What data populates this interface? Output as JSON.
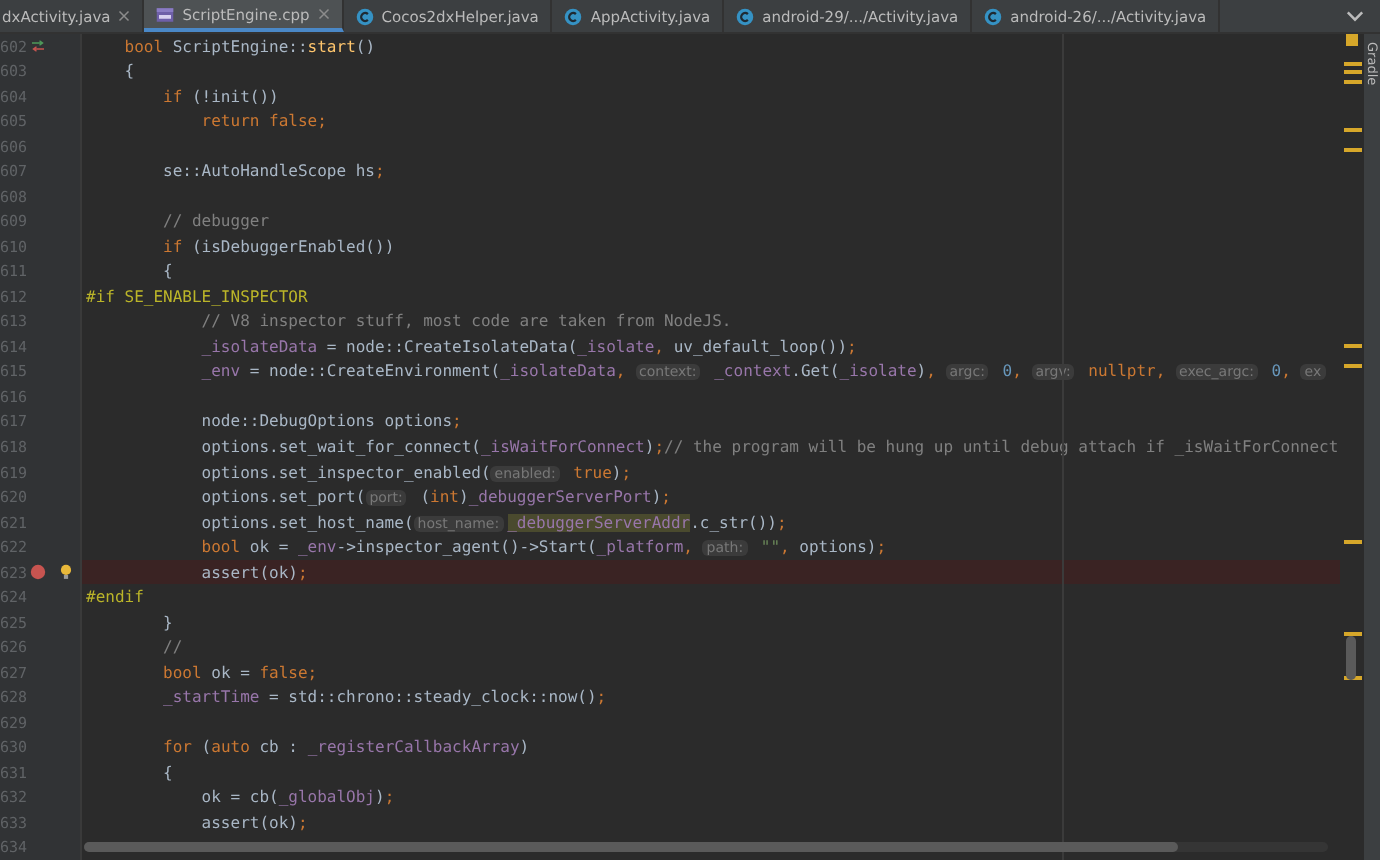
{
  "tabs": [
    {
      "label": "dxActivity.java",
      "selected": false,
      "kind": "none",
      "closable": true
    },
    {
      "label": "ScriptEngine.cpp",
      "selected": true,
      "kind": "cpp",
      "closable": true
    },
    {
      "label": "Cocos2dxHelper.java",
      "selected": false,
      "kind": "java",
      "closable": false
    },
    {
      "label": "AppActivity.java",
      "selected": false,
      "kind": "java",
      "closable": false
    },
    {
      "label": "android-29/.../Activity.java",
      "selected": false,
      "kind": "java",
      "closable": false
    },
    {
      "label": "android-26/.../Activity.java",
      "selected": false,
      "kind": "java",
      "closable": false
    }
  ],
  "side_tool": "Gradle",
  "lines": [
    {
      "number": "602",
      "breakpoint": false,
      "gutter_icon": {
        "kind": "override"
      },
      "tokens": [
        {
          "kind": "keyword",
          "text": "    bool "
        },
        {
          "kind": "plain",
          "text": "ScriptEngine::"
        },
        {
          "kind": "function",
          "text": "start"
        },
        {
          "kind": "plain",
          "text": "()"
        }
      ]
    },
    {
      "number": "603",
      "breakpoint": false,
      "tokens": [
        {
          "kind": "plain",
          "text": "    {"
        }
      ]
    },
    {
      "number": "604",
      "breakpoint": false,
      "tokens": [
        {
          "kind": "keyword",
          "text": "        if "
        },
        {
          "kind": "plain",
          "text": "(!init())"
        }
      ]
    },
    {
      "number": "605",
      "breakpoint": false,
      "tokens": [
        {
          "kind": "keyword",
          "text": "            return false;"
        }
      ]
    },
    {
      "number": "606",
      "breakpoint": false
    },
    {
      "number": "607",
      "breakpoint": false,
      "tokens": [
        {
          "kind": "plain",
          "text": "        se::AutoHandleScope hs"
        },
        {
          "kind": "keyword",
          "text": ";"
        }
      ]
    },
    {
      "number": "608",
      "breakpoint": false
    },
    {
      "number": "609",
      "breakpoint": false,
      "tokens": [
        {
          "kind": "comment",
          "text": "        // debugger"
        }
      ]
    },
    {
      "number": "610",
      "breakpoint": false,
      "tokens": [
        {
          "kind": "keyword",
          "text": "        if "
        },
        {
          "kind": "plain",
          "text": "(isDebuggerEnabled())"
        }
      ]
    },
    {
      "number": "611",
      "breakpoint": false,
      "tokens": [
        {
          "kind": "plain",
          "text": "        {"
        }
      ]
    },
    {
      "number": "612",
      "breakpoint": false,
      "tokens": [
        {
          "kind": "macro",
          "text": "#if SE_ENABLE_INSPECTOR"
        }
      ]
    },
    {
      "number": "613",
      "breakpoint": false,
      "tokens": [
        {
          "kind": "comment",
          "text": "            // V8 inspector stuff, most code are taken from NodeJS."
        }
      ]
    },
    {
      "number": "614",
      "breakpoint": false,
      "tokens": [
        {
          "kind": "member",
          "text": "            _isolateData"
        },
        {
          "kind": "plain",
          "text": " = node::CreateIsolateData("
        },
        {
          "kind": "member",
          "text": "_isolate"
        },
        {
          "kind": "keyword",
          "text": ", "
        },
        {
          "kind": "plain",
          "text": "uv_default_loop())"
        },
        {
          "kind": "keyword",
          "text": ";"
        }
      ]
    },
    {
      "number": "615",
      "breakpoint": false,
      "tokens": [
        {
          "kind": "member",
          "text": "            _env"
        },
        {
          "kind": "plain",
          "text": " = node::CreateEnvironment("
        },
        {
          "kind": "member",
          "text": "_isolateData"
        },
        {
          "kind": "keyword",
          "text": ", "
        },
        {
          "kind": "hint",
          "text": "context:"
        },
        {
          "kind": "member",
          "text": " _context"
        },
        {
          "kind": "plain",
          "text": ".Get("
        },
        {
          "kind": "member",
          "text": "_isolate"
        },
        {
          "kind": "plain",
          "text": ")"
        },
        {
          "kind": "keyword",
          "text": ", "
        },
        {
          "kind": "hint",
          "text": "argc:"
        },
        {
          "kind": "number",
          "text": " 0"
        },
        {
          "kind": "keyword",
          "text": ", "
        },
        {
          "kind": "hint",
          "text": "argv:"
        },
        {
          "kind": "keyword",
          "text": " nullptr, "
        },
        {
          "kind": "hint",
          "text": "exec_argc:"
        },
        {
          "kind": "number",
          "text": " 0"
        },
        {
          "kind": "keyword",
          "text": ", "
        },
        {
          "kind": "hint",
          "text": "ex"
        }
      ]
    },
    {
      "number": "616",
      "breakpoint": false
    },
    {
      "number": "617",
      "breakpoint": false,
      "tokens": [
        {
          "kind": "plain",
          "text": "            node::DebugOptions options"
        },
        {
          "kind": "keyword",
          "text": ";"
        }
      ]
    },
    {
      "number": "618",
      "breakpoint": false,
      "tokens": [
        {
          "kind": "plain",
          "text": "            options.set_wait_for_connect("
        },
        {
          "kind": "member",
          "text": "_isWaitForConnect"
        },
        {
          "kind": "plain",
          "text": ")"
        },
        {
          "kind": "keyword",
          "text": ";"
        },
        {
          "kind": "comment",
          "text": "// the program will be hung up until debug attach if _isWaitForConnect"
        }
      ]
    },
    {
      "number": "619",
      "breakpoint": false,
      "tokens": [
        {
          "kind": "plain",
          "text": "            options.set_inspector_enabled("
        },
        {
          "kind": "hint",
          "text": "enabled:"
        },
        {
          "kind": "keyword",
          "text": " true"
        },
        {
          "kind": "plain",
          "text": ")"
        },
        {
          "kind": "keyword",
          "text": ";"
        }
      ]
    },
    {
      "number": "620",
      "breakpoint": false,
      "tokens": [
        {
          "kind": "plain",
          "text": "            options.set_port("
        },
        {
          "kind": "hint",
          "text": "port:"
        },
        {
          "kind": "plain",
          "text": " ("
        },
        {
          "kind": "keyword",
          "text": "int"
        },
        {
          "kind": "plain",
          "text": ")"
        },
        {
          "kind": "member",
          "text": "_debuggerServerPort"
        },
        {
          "kind": "plain",
          "text": ")"
        },
        {
          "kind": "keyword",
          "text": ";"
        }
      ]
    },
    {
      "number": "621",
      "breakpoint": false,
      "tokens": [
        {
          "kind": "plain",
          "text": "            options.set_host_name("
        },
        {
          "kind": "hint",
          "text": "host_name:"
        },
        {
          "kind": "highlight",
          "text": "_debuggerServerAddr"
        },
        {
          "kind": "plain",
          "text": ".c_str())"
        },
        {
          "kind": "keyword",
          "text": ";"
        }
      ]
    },
    {
      "number": "622",
      "breakpoint": false,
      "tokens": [
        {
          "kind": "keyword",
          "text": "            bool "
        },
        {
          "kind": "plain",
          "text": "ok = "
        },
        {
          "kind": "member",
          "text": "_env"
        },
        {
          "kind": "plain",
          "text": "->inspector_agent()->Start("
        },
        {
          "kind": "member",
          "text": "_platform"
        },
        {
          "kind": "keyword",
          "text": ", "
        },
        {
          "kind": "hint",
          "text": "path:"
        },
        {
          "kind": "string",
          "text": " \"\""
        },
        {
          "kind": "keyword",
          "text": ", "
        },
        {
          "kind": "plain",
          "text": "options)"
        },
        {
          "kind": "keyword",
          "text": ";"
        }
      ]
    },
    {
      "number": "623",
      "breakpoint": true,
      "gutter_icon": {
        "kind": "bulb"
      },
      "tokens": [
        {
          "kind": "plain",
          "text": "            assert(ok)"
        },
        {
          "kind": "keyword",
          "text": ";"
        }
      ]
    },
    {
      "number": "624",
      "breakpoint": false,
      "tokens": [
        {
          "kind": "macro",
          "text": "#endif"
        }
      ]
    },
    {
      "number": "625",
      "breakpoint": false,
      "tokens": [
        {
          "kind": "plain",
          "text": "        }"
        }
      ]
    },
    {
      "number": "626",
      "breakpoint": false,
      "tokens": [
        {
          "kind": "comment",
          "text": "        //"
        }
      ]
    },
    {
      "number": "627",
      "breakpoint": false,
      "tokens": [
        {
          "kind": "keyword",
          "text": "        bool "
        },
        {
          "kind": "plain",
          "text": "ok = "
        },
        {
          "kind": "keyword",
          "text": "false;"
        }
      ]
    },
    {
      "number": "628",
      "breakpoint": false,
      "tokens": [
        {
          "kind": "member",
          "text": "        _startTime"
        },
        {
          "kind": "plain",
          "text": " = std::chrono::steady_clock::now()"
        },
        {
          "kind": "keyword",
          "text": ";"
        }
      ]
    },
    {
      "number": "629",
      "breakpoint": false
    },
    {
      "number": "630",
      "breakpoint": false,
      "tokens": [
        {
          "kind": "keyword",
          "text": "        for "
        },
        {
          "kind": "plain",
          "text": "("
        },
        {
          "kind": "keyword",
          "text": "auto "
        },
        {
          "kind": "plain",
          "text": "cb : "
        },
        {
          "kind": "member",
          "text": "_registerCallbackArray"
        },
        {
          "kind": "plain",
          "text": ")"
        }
      ]
    },
    {
      "number": "631",
      "breakpoint": false,
      "tokens": [
        {
          "kind": "plain",
          "text": "        {"
        }
      ]
    },
    {
      "number": "632",
      "breakpoint": false,
      "tokens": [
        {
          "kind": "plain",
          "text": "            ok = cb("
        },
        {
          "kind": "member",
          "text": "_globalObj"
        },
        {
          "kind": "plain",
          "text": ")"
        },
        {
          "kind": "keyword",
          "text": ";"
        }
      ]
    },
    {
      "number": "633",
      "breakpoint": false,
      "tokens": [
        {
          "kind": "plain",
          "text": "            assert(ok)"
        },
        {
          "kind": "keyword",
          "text": ";"
        }
      ]
    },
    {
      "number": "634",
      "breakpoint": false
    }
  ]
}
